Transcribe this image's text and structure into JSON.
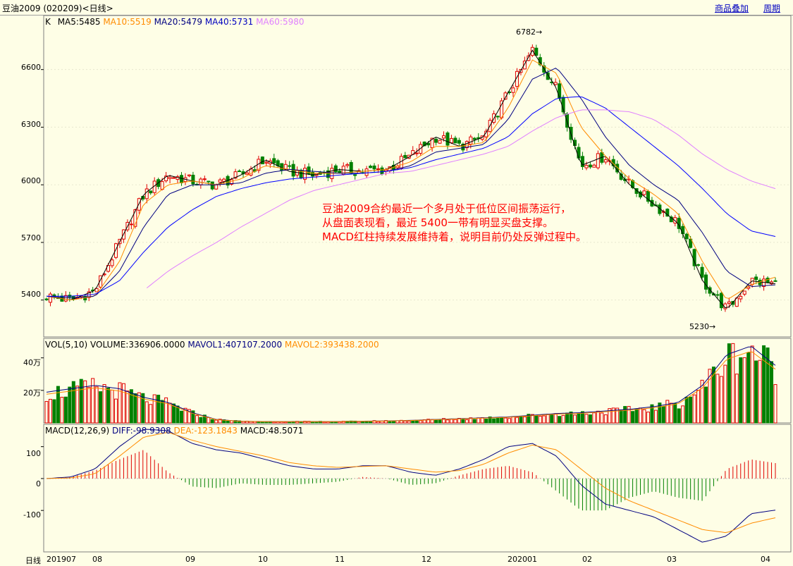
{
  "title": "豆油2009 (020209)<日线>",
  "links": {
    "overlay": "商品叠加",
    "period": "周期"
  },
  "period_label": "日线",
  "annotation": [
    "豆油2009合约最近一个多月处于低位区间振荡运行，",
    "从盘面表现看，最近 5400一带有明显买盘支撑。",
    "MACD红柱持续发展维持着，说明目前仍处反弹过程中。"
  ],
  "colors": {
    "up": "#e00000",
    "down": "#008000",
    "ma5": "#000000",
    "ma10": "#ff8c00",
    "ma20": "#000080",
    "ma40": "#0000ff",
    "ma60": "#e080ff",
    "bg": "#fefee6",
    "grid": "#e0e0d0"
  },
  "chart_data": [
    {
      "type": "candlestick",
      "panel": "price",
      "legend": [
        {
          "text": "K",
          "color": "#000000"
        },
        {
          "text": "MA5:5485",
          "color": "#000000"
        },
        {
          "text": "MA10:5519",
          "color": "#ff8c00"
        },
        {
          "text": "MA20:5479",
          "color": "#000080"
        },
        {
          "text": "MA40:5731",
          "color": "#0000c0"
        },
        {
          "text": "MA60:5980",
          "color": "#e080ff"
        }
      ],
      "yticks": [
        "5400",
        "5700",
        "6000",
        "6300",
        "6600"
      ],
      "ylim": [
        5230,
        6830
      ],
      "markers": [
        {
          "label": "6782",
          "value": 6782
        },
        {
          "label": "5230",
          "value": 5230
        }
      ],
      "xticks": [
        "201907",
        "08",
        "09",
        "10",
        "11",
        "12",
        "202001",
        "02",
        "03",
        "04"
      ],
      "series": [
        {
          "name": "MA5",
          "values": [
            5420,
            5400,
            5450,
            5700,
            5950,
            6050,
            6020,
            6000,
            6050,
            6130,
            6070,
            6050,
            6080,
            6070,
            6080,
            6150,
            6250,
            6200,
            6250,
            6480,
            6700,
            6500,
            6100,
            6150,
            6000,
            5900,
            5800,
            5500,
            5350,
            5500,
            5485
          ]
        },
        {
          "name": "MA10",
          "values": [
            5420,
            5400,
            5420,
            5600,
            5900,
            6000,
            6020,
            6000,
            6030,
            6100,
            6080,
            6060,
            6060,
            6070,
            6080,
            6120,
            6200,
            6200,
            6220,
            6400,
            6650,
            6580,
            6300,
            6150,
            6030,
            5950,
            5850,
            5600,
            5400,
            5480,
            5519
          ]
        },
        {
          "name": "MA20",
          "values": [
            5420,
            5410,
            5420,
            5550,
            5780,
            5950,
            6000,
            6000,
            6010,
            6060,
            6080,
            6070,
            6060,
            6060,
            6070,
            6100,
            6170,
            6190,
            6210,
            6340,
            6550,
            6610,
            6450,
            6250,
            6100,
            6000,
            5920,
            5750,
            5550,
            5470,
            5479
          ]
        },
        {
          "name": "MA40",
          "values": [
            5420,
            5420,
            5430,
            5500,
            5650,
            5780,
            5870,
            5940,
            5980,
            6010,
            6030,
            6040,
            6050,
            6060,
            6070,
            6090,
            6130,
            6160,
            6190,
            6250,
            6370,
            6450,
            6460,
            6400,
            6300,
            6200,
            6100,
            5980,
            5850,
            5760,
            5731
          ]
        },
        {
          "name": "MA60",
          "values": [
            null,
            null,
            null,
            null,
            5450,
            5550,
            5630,
            5700,
            5780,
            5850,
            5920,
            5970,
            6000,
            6030,
            6060,
            6070,
            6100,
            6130,
            6160,
            6200,
            6280,
            6350,
            6390,
            6390,
            6380,
            6340,
            6260,
            6160,
            6080,
            6020,
            5980
          ]
        }
      ]
    },
    {
      "type": "bar",
      "panel": "volume",
      "legend": [
        {
          "text": "VOL(5,10) VOLUME:336906.0000",
          "color": "#000000"
        },
        {
          "text": "MAVOL1:407107.2000",
          "color": "#000080"
        },
        {
          "text": "MAVOL2:393438.2000",
          "color": "#ff8c00"
        }
      ],
      "yticks": [
        "20万",
        "40万"
      ],
      "ylim": [
        0,
        520000
      ],
      "values": [
        180000,
        200000,
        220000,
        200000,
        150000,
        120000,
        60000,
        20000,
        10000,
        8000,
        8000,
        8000,
        8000,
        10000,
        12000,
        15000,
        20000,
        25000,
        30000,
        35000,
        45000,
        55000,
        60000,
        70000,
        80000,
        95000,
        120000,
        220000,
        400000,
        450000,
        336906
      ]
    },
    {
      "type": "bar",
      "panel": "macd",
      "legend": [
        {
          "text": "MACD(12,26,9)",
          "color": "#000000"
        },
        {
          "text": "DIFF:-98.9308",
          "color": "#000080"
        },
        {
          "text": "DEA:-123.1843",
          "color": "#ff8c00"
        },
        {
          "text": "MACD:48.5071",
          "color": "#000000"
        }
      ],
      "yticks": [
        "-100",
        "0",
        "100"
      ],
      "ylim": [
        -230,
        170
      ],
      "series": [
        {
          "name": "DIFF",
          "values": [
            0,
            5,
            30,
            100,
            155,
            150,
            110,
            90,
            80,
            60,
            40,
            30,
            30,
            40,
            40,
            20,
            10,
            30,
            60,
            100,
            110,
            70,
            -20,
            -80,
            -100,
            -120,
            -160,
            -200,
            -180,
            -110,
            -99
          ]
        },
        {
          "name": "DEA",
          "values": [
            0,
            2,
            15,
            70,
            130,
            145,
            120,
            100,
            85,
            70,
            50,
            40,
            35,
            38,
            40,
            30,
            20,
            25,
            45,
            80,
            105,
            90,
            30,
            -30,
            -70,
            -100,
            -130,
            -160,
            -170,
            -140,
            -123
          ]
        },
        {
          "name": "MACD",
          "values": [
            0,
            5,
            25,
            60,
            90,
            20,
            -25,
            -30,
            -15,
            -20,
            -20,
            -15,
            -10,
            5,
            0,
            -20,
            -15,
            10,
            30,
            40,
            20,
            -40,
            -100,
            -100,
            -60,
            -40,
            -60,
            -70,
            30,
            60,
            48.5
          ]
        }
      ]
    }
  ]
}
